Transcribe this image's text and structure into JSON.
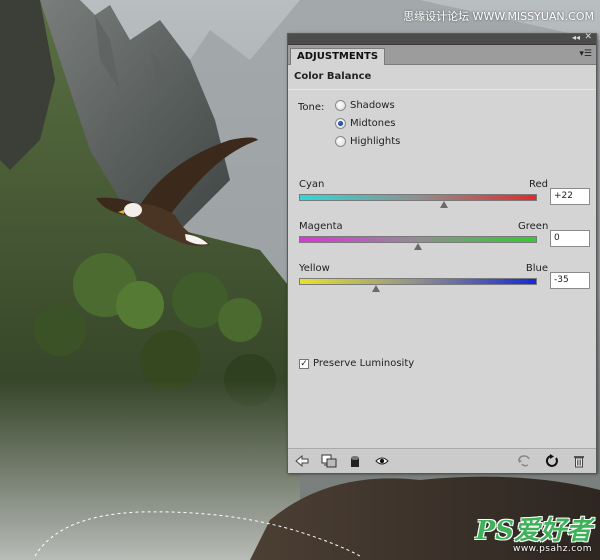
{
  "watermark": {
    "top_text": "思缘设计论坛 WWW.MISSYUAN.COM",
    "logo_mark": "PS爱好者",
    "logo_url": "www.psahz.com"
  },
  "panel": {
    "tab_label": "ADJUSTMENTS",
    "adjustment_title": "Color Balance",
    "tone": {
      "label": "Tone:",
      "options": [
        "Shadows",
        "Midtones",
        "Highlights"
      ],
      "selected": "Midtones"
    },
    "sliders": [
      {
        "left": "Cyan",
        "right": "Red",
        "value": "+22",
        "position": 0.61,
        "gradient": [
          "#2fd8d8",
          "#e12b2b"
        ]
      },
      {
        "left": "Magenta",
        "right": "Green",
        "value": "0",
        "position": 0.5,
        "gradient": [
          "#d936d9",
          "#37c834"
        ]
      },
      {
        "left": "Yellow",
        "right": "Blue",
        "value": "-35",
        "position": 0.325,
        "gradient": [
          "#e7e22a",
          "#1629d6"
        ]
      }
    ],
    "preserve_luminosity": {
      "label": "Preserve Luminosity",
      "checked": true
    },
    "footer_icons": [
      "back-arrow-icon",
      "clip-to-layer-icon",
      "layer-visibility-mask-icon",
      "eye-icon",
      "view-previous-state-icon",
      "reset-icon",
      "trash-icon"
    ]
  },
  "colors": {
    "panel_bg": "#d4d4d4",
    "tab_strip": "#9c9c9c",
    "title_strip": "#4c4c4c"
  }
}
